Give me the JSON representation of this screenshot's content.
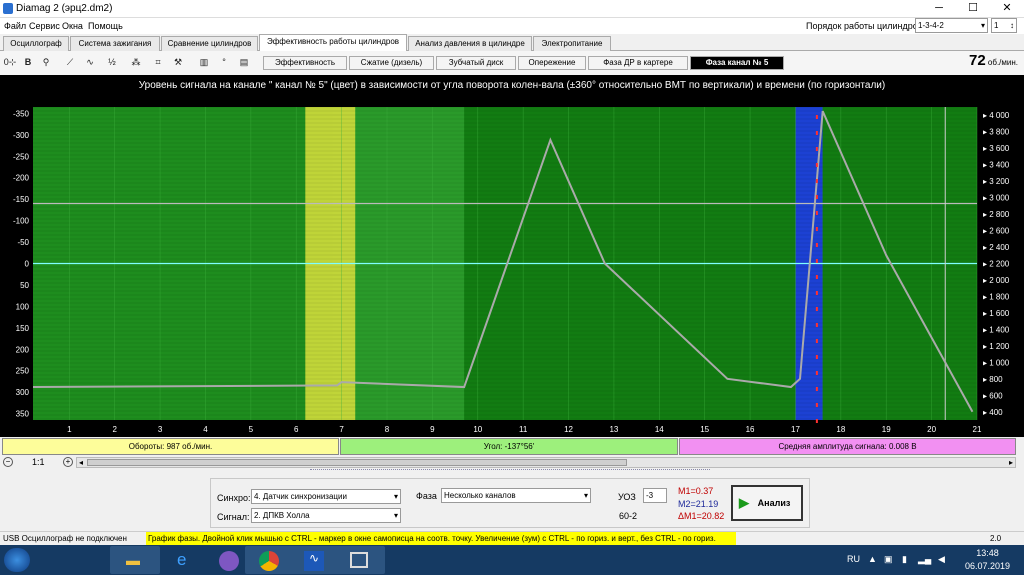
{
  "window": {
    "title": "Diamag 2 (эрц2.dm2)",
    "minimize": "─",
    "maximize": "☐",
    "close": "✕"
  },
  "menu": [
    "Файл",
    "Сервис",
    "Окна",
    "Помощь"
  ],
  "cylinder_order": {
    "label": "Порядок работы цилиндров",
    "value": "1-3-4-2",
    "cyl": "1"
  },
  "tabs_main": [
    "Осциллограф",
    "Система зажигания",
    "Сравнение цилиндров",
    "Эффективность работы цилиндров",
    "Анализ давления в цилиндре",
    "Электропитание"
  ],
  "tabs_sub": [
    "Эффективность",
    "Сжатие (дизель)",
    "Зубчатый диск",
    "Опережение",
    "Фаза ДР в картере",
    "Фаза  канал № 5"
  ],
  "rpm": {
    "value": "72",
    "unit": "об./мин."
  },
  "colors": {
    "green": "#1e8c1e",
    "yellow": "#d8e83a",
    "blue": "#1b3cdc",
    "trace": "#b0b0b0"
  },
  "chart_data": {
    "type": "heatmap",
    "title": "Уровень сигнала на канале \" канал № 5\" (цвет) в зависимости от угла поворота колен-вала (±360° относительно ВМТ по вертикали) и времени (по горизонтали)",
    "x_ticks": [
      "1",
      "2",
      "3",
      "4",
      "5",
      "6",
      "7",
      "8",
      "9",
      "10",
      "11",
      "12",
      "13",
      "14",
      "15",
      "16",
      "17",
      "18",
      "19",
      "20",
      "21"
    ],
    "y_ticks": [
      "-350",
      "-300",
      "-250",
      "-200",
      "-150",
      "-100",
      "-50",
      "0",
      "50",
      "100",
      "150",
      "200",
      "250",
      "300",
      "350"
    ],
    "y2_ticks": [
      "4 000",
      "3 800",
      "3 600",
      "3 400",
      "3 200",
      "3 000",
      "2 800",
      "2 600",
      "2 400",
      "2 200",
      "2 000",
      "1 800",
      "1 600",
      "1 400",
      "1 200",
      "1 000",
      "800",
      "600",
      "400"
    ],
    "ylim": [
      -365,
      365
    ],
    "y2lim": [
      300,
      4100
    ],
    "xlim": [
      0.2,
      21
    ],
    "bands": [
      {
        "x0": 0.2,
        "x1": 6.8,
        "color": "#1e8c1e"
      },
      {
        "x0": 6.2,
        "x1": 7.3,
        "color": "#c8d83a"
      },
      {
        "x0": 9.7,
        "x1": 17.0,
        "color": "#117a11"
      },
      {
        "x0": 17.0,
        "x1": 17.6,
        "color": "#1b3cdc"
      },
      {
        "x0": 17.6,
        "x1": 21,
        "color": "#117a11"
      }
    ],
    "rpm_series": {
      "x": [
        0.2,
        6.9,
        7.0,
        9.7,
        11.6,
        12.8,
        15.5,
        16.9,
        17.1,
        17.6,
        19.0,
        20.9
      ],
      "y": [
        700,
        720,
        760,
        700,
        3700,
        2200,
        800,
        700,
        800,
        4050,
        2300,
        400
      ]
    },
    "hlines": [
      {
        "y": -140,
        "color": "#bbbbbb"
      },
      {
        "y": 0,
        "color": "#7fffff"
      }
    ],
    "vline_x": 20.3
  },
  "status": {
    "rpm": "Обороты:  987 об./мин.",
    "angle": "Угол:  -137°56'",
    "amp": "Средняя амплитуда сигнала:  0.008 В"
  },
  "scale": {
    "zoom": "1:1"
  },
  "panel": {
    "sync_label": "Синхро:",
    "sync_value": "4.  Датчик синхронизации",
    "signal_label": "Сигнал:",
    "signal_value": "2.  ДПКВ Холла",
    "phase_label": "Фаза",
    "phase_value": "Несколько каналов",
    "uoz_label": "УОЗ",
    "uoz_value": "-3",
    "teeth": "60-2",
    "m1": "M1=0.37",
    "m2": "M2=21.19",
    "dm": "ΔM1=20.82",
    "analyze": "Анализ"
  },
  "bottom": {
    "usb": "USB Осциллограф не подключен",
    "hint": "График фазы. Двойной клик мышью с CTRL - маркер в окне самописца на соотв. точку. Увеличение (зум) с CTRL - по гориз. и верт., без CTRL - по гориз.",
    "version": "2.0"
  },
  "taskbar": {
    "lang": "RU",
    "time": "13:48",
    "date": "06.07.2019"
  }
}
